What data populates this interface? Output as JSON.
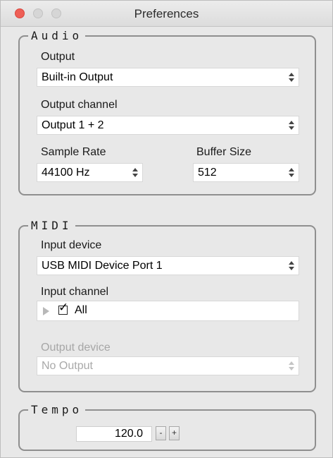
{
  "window": {
    "title": "Preferences"
  },
  "audio": {
    "legend": "Audio",
    "output_label": "Output",
    "output_value": "Built-in Output",
    "output_channel_label": "Output channel",
    "output_channel_value": "Output 1 + 2",
    "sample_rate_label": "Sample Rate",
    "sample_rate_value": "44100 Hz",
    "buffer_size_label": "Buffer Size",
    "buffer_size_value": "512"
  },
  "midi": {
    "legend": "MIDI",
    "input_device_label": "Input device",
    "input_device_value": "USB MIDI Device Port 1",
    "input_channel_label": "Input channel",
    "input_channel_item": "All",
    "input_channel_checked": true,
    "output_device_label": "Output device",
    "output_device_value": "No Output"
  },
  "tempo": {
    "legend": "Tempo",
    "value": "120.0",
    "minus_label": "-",
    "plus_label": "+"
  },
  "colors": {
    "close": "#ee5f56",
    "window_bg": "#e8e8e8",
    "group_border": "#8f8f8f"
  },
  "icons": [
    "close-button",
    "minimize-button",
    "zoom-button",
    "updown-arrows-icon",
    "disclosure-triangle-icon",
    "checkmark-icon"
  ]
}
